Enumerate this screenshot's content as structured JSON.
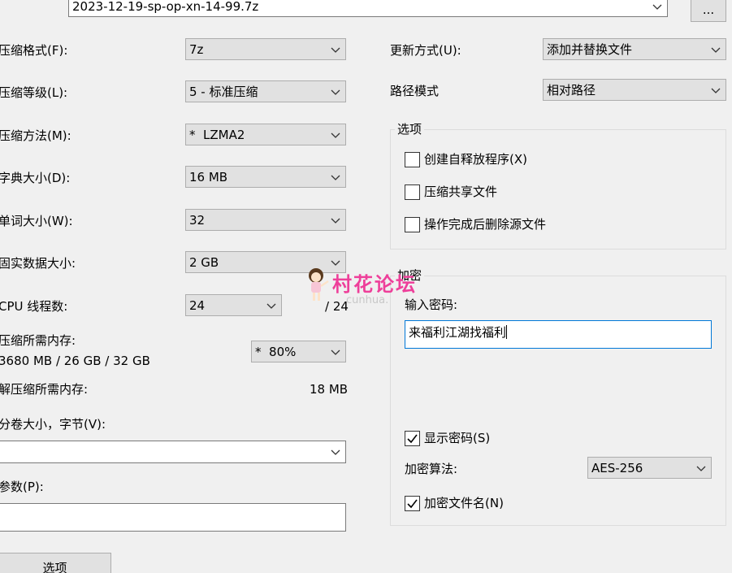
{
  "archive": {
    "filename": "2023-12-19-sp-op-xn-14-99.7z",
    "browse_label": "..."
  },
  "left": {
    "format": {
      "label": "压缩格式(F):",
      "value": "7z"
    },
    "level": {
      "label": "压缩等级(L):",
      "value": "5 - 标准压缩"
    },
    "method": {
      "label": "压缩方法(M):",
      "value": "*  LZMA2"
    },
    "dict": {
      "label": "字典大小(D):",
      "value": "16 MB"
    },
    "word": {
      "label": "单词大小(W):",
      "value": "32"
    },
    "solid": {
      "label": "固实数据大小:",
      "value": "2 GB"
    },
    "threads": {
      "label": "CPU 线程数:",
      "value": "24",
      "max": "/ 24"
    },
    "mem_compress": {
      "label": "压缩所需内存:",
      "detail": "3680 MB / 26 GB / 32 GB",
      "value": "*  80%"
    },
    "mem_decompress": {
      "label": "解压缩所需内存:",
      "value": "18 MB"
    },
    "volume": {
      "label": "分卷大小，字节(V):",
      "value": ""
    },
    "params": {
      "label": "参数(P):",
      "value": ""
    },
    "options_button": "选项"
  },
  "right": {
    "update": {
      "label": "更新方式(U):",
      "value": "添加并替换文件"
    },
    "path": {
      "label": "路径模式",
      "value": "相对路径"
    },
    "options_group": {
      "title": "选项",
      "sfx": {
        "label": "创建自释放程序(X)",
        "checked": false
      },
      "shared": {
        "label": "压缩共享文件",
        "checked": false
      },
      "delete_after": {
        "label": "操作完成后删除源文件",
        "checked": false
      }
    },
    "encryption_group": {
      "title": "加密",
      "password_label": "输入密码:",
      "password_value": "来福利江湖找福利",
      "show_password": {
        "label": "显示密码(S)",
        "checked": true
      },
      "method_label": "加密算法:",
      "method_value": "AES-256",
      "encrypt_names": {
        "label": "加密文件名(N)",
        "checked": true
      }
    }
  },
  "watermark": {
    "text": "村花论坛",
    "sub": "cunhua."
  },
  "icons": {
    "chevron": "chevron-down-icon",
    "check": "check-icon"
  },
  "colors": {
    "watermark": "#ee3f9a",
    "focus_border": "#0078d7",
    "control_bg": "#e1e1e1",
    "window_bg": "#f0f0f0"
  }
}
